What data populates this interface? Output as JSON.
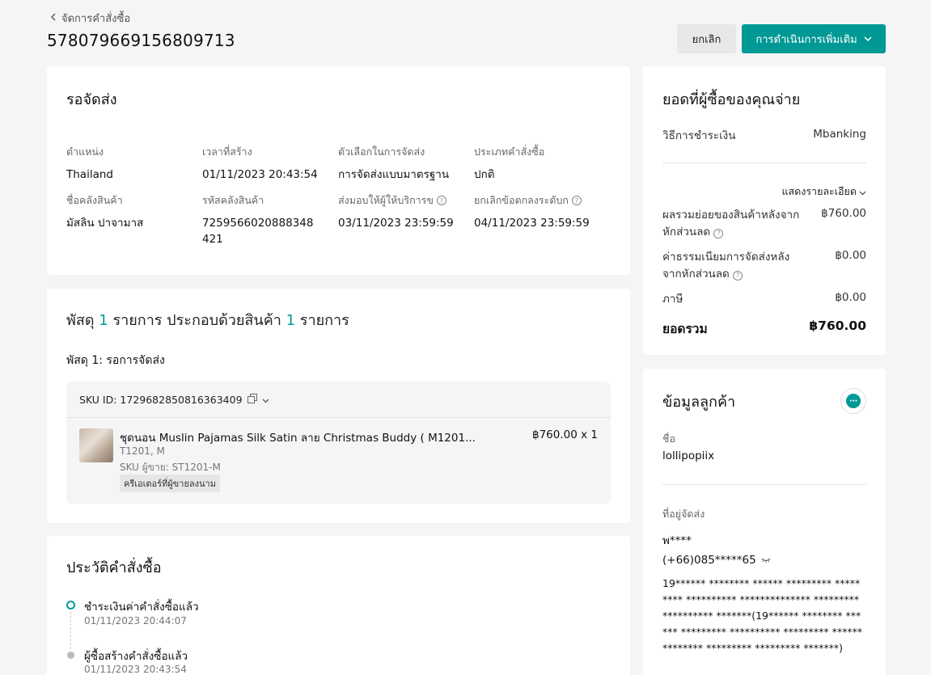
{
  "header": {
    "back_label": "จัดการคำสั่งซื้อ",
    "order_id": "578079669156809713",
    "cancel_label": "ยกเลิก",
    "more_actions_label": "การดำเนินการเพิ่มเติม"
  },
  "status": {
    "title": "รอจัดส่ง",
    "fields": [
      {
        "label": "ตำแหน่ง",
        "value": "Thailand"
      },
      {
        "label": "เวลาที่สร้าง",
        "value": "01/11/2023 20:43:54"
      },
      {
        "label": "ตัวเลือกในการจัดส่ง",
        "value": "การจัดส่งแบบมาตรฐาน"
      },
      {
        "label": "ประเภทคำสั่งซื้อ",
        "value": "ปกติ"
      },
      {
        "label": "ชื่อคลังสินค้า",
        "value": "มัสลิน ปาจามาส"
      },
      {
        "label": "รหัสคลังสินค้า",
        "value": "7259566020888348421"
      },
      {
        "label": "ส่งมอบให้ผู้ให้บริการข",
        "value": "03/11/2023 23:59:59"
      },
      {
        "label": "ยกเลิกข้อตกลงระดับก",
        "value": "04/11/2023 23:59:59"
      }
    ]
  },
  "package": {
    "title_prefix": "พัสดุ",
    "package_count": "1",
    "title_mid": "รายการ ประกอบด้วยสินค้า",
    "item_count": "1",
    "title_suffix": "รายการ",
    "subtitle": "พัสดุ 1: รอการจัดส่ง",
    "sku_id": "SKU ID: 1729682850816363409",
    "product": {
      "name": "ชุดนอน Muslin Pajamas Silk Satin ลาย Christmas Buddy ( M1201...",
      "variant": "T1201, M",
      "seller_sku": "SKU ผู้ขาย: ST1201-M",
      "tag": "ครีเอเตอร์ที่ผู้ขายลงนาม",
      "price_qty": "฿760.00 x 1"
    }
  },
  "history": {
    "title": "ประวัติคำสั่งซื้อ",
    "events": [
      {
        "label": "ชำระเงินค่าคำสั่งซื้อแล้ว",
        "time": "01/11/2023 20:44:07"
      },
      {
        "label": "ผู้ซื้อสร้างคำสั่งซื้อแล้ว",
        "time": "01/11/2023 20:43:54"
      }
    ]
  },
  "payment": {
    "title": "ยอดที่ผู้ซื้อของคุณจ่าย",
    "method_label": "วิธีการชำระเงิน",
    "method_value": "Mbanking",
    "detail_link": "แสดงรายละเอียด",
    "subtotal_label": "ผลรวมย่อยของสินค้าหลังจากหักส่วนลด",
    "subtotal_value": "฿760.00",
    "shipping_label": "ค่าธรรมเนียมการจัดส่งหลังจากหักส่วนลด",
    "shipping_value": "฿0.00",
    "tax_label": "ภาษี",
    "tax_value": "฿0.00",
    "total_label": "ยอดรวม",
    "total_value": "฿760.00"
  },
  "customer": {
    "title": "ข้อมูลลูกค้า",
    "name_label": "ชื่อ",
    "name_value": "lollipopiix",
    "address_label": "ที่อยู่จัดส่ง",
    "recipient": "พ****",
    "phone": "(+66)085*****65",
    "address": "19****** ******** ****** ********* ********* ********** ************** ********* ********** *******(19****** ******** ****** ********* ********** ********* ************** ********* ********* *******)"
  },
  "colors": {
    "accent": "#009995",
    "background": "#f5f5f5"
  }
}
